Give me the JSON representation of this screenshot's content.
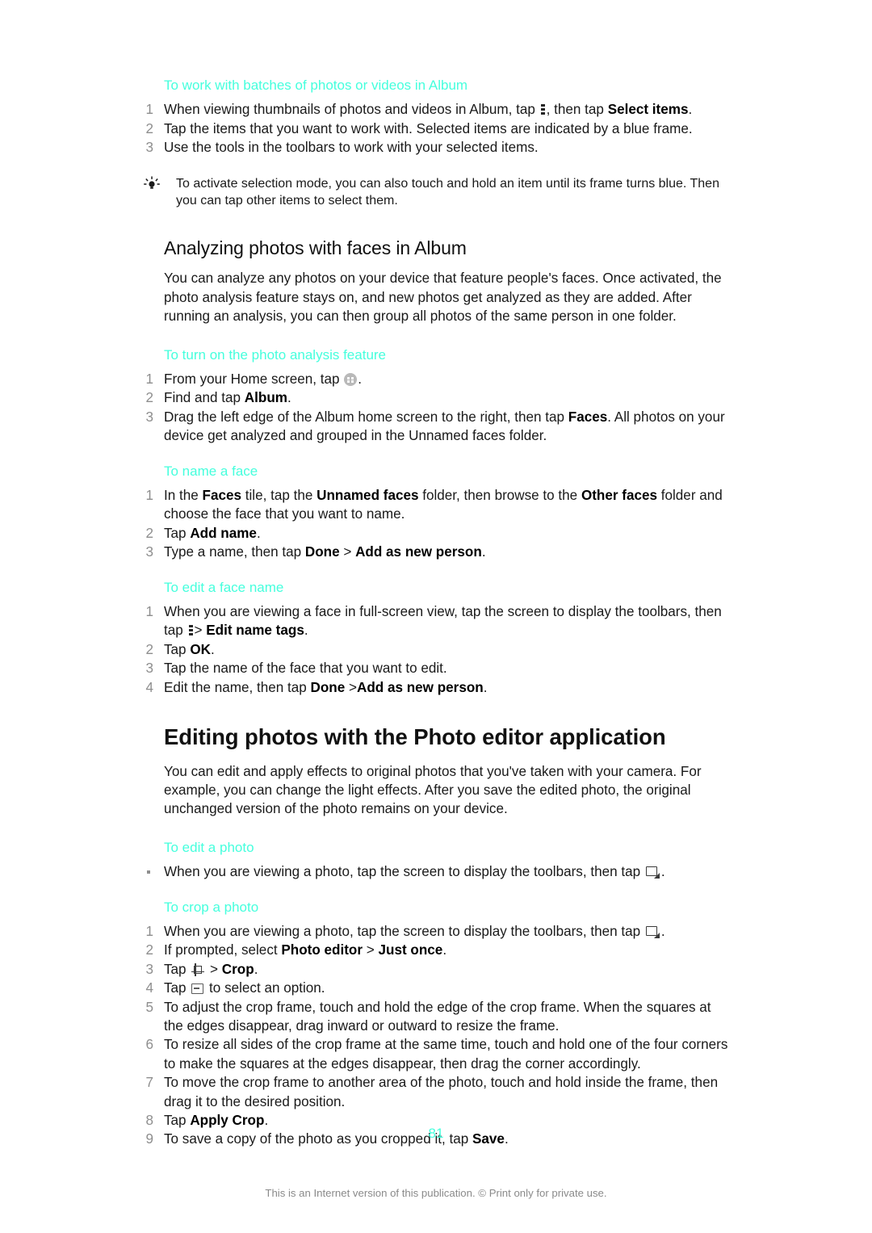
{
  "document": {
    "page_number": "81",
    "footer_note": "This is an Internet version of this publication. © Print only for private use.",
    "accent_color": "#45ffdd",
    "text_color": "#1a1a1a",
    "number_color": "#8e8e8e"
  },
  "sections": {
    "batches": {
      "heading": "To work with batches of photos or videos in Album",
      "steps": {
        "s1_a": "When viewing thumbnails of photos and videos in Album, tap ",
        "s1_icon": "overflow-menu-icon",
        "s1_b": ", then tap ",
        "s1_bold": "Select items",
        "s1_c": ".",
        "s2": "Tap the items that you want to work with. Selected items are indicated by a blue frame.",
        "s3": "Use the tools in the toolbars to work with your selected items."
      },
      "tip": "To activate selection mode, you can also touch and hold an item until its frame turns blue. Then you can tap other items to select them.",
      "tip_icon": "lightbulb-tip-icon"
    },
    "analyzing": {
      "heading": "Analyzing photos with faces in Album",
      "intro": "You can analyze any photos on your device that feature people's faces. Once activated, the photo analysis feature stays on, and new photos get analyzed as they are added. After running an analysis, you can then group all photos of the same person in one folder.",
      "turn_on": {
        "heading": "To turn on the photo analysis feature",
        "s1_a": "From your Home screen, tap ",
        "s1_icon": "app-drawer-icon",
        "s1_b": ".",
        "s2_a": "Find and tap ",
        "s2_bold": "Album",
        "s2_b": ".",
        "s3_a": "Drag the left edge of the Album home screen to the right, then tap ",
        "s3_bold": "Faces",
        "s3_b": ". All photos on your device get analyzed and grouped in the Unnamed faces folder."
      },
      "name_face": {
        "heading": "To name a face",
        "s1_a": "In the ",
        "s1_bold1": "Faces",
        "s1_b": " tile, tap the ",
        "s1_bold2": "Unnamed faces",
        "s1_c": " folder, then browse to the ",
        "s1_bold3": "Other faces",
        "s1_d": " folder and choose the face that you want to name.",
        "s2_a": "Tap ",
        "s2_bold": "Add name",
        "s2_b": ".",
        "s3_a": "Type a name, then tap ",
        "s3_bold1": "Done",
        "s3_b": " > ",
        "s3_bold2": "Add as new person",
        "s3_c": "."
      },
      "edit_face": {
        "heading": "To edit a face name",
        "s1_a": "When you are viewing a face in full-screen view, tap the screen to display the toolbars, then tap ",
        "s1_icon": "overflow-menu-icon",
        "s1_b": "> ",
        "s1_bold": "Edit name tags",
        "s1_c": ".",
        "s2_a": "Tap ",
        "s2_bold": "OK",
        "s2_b": ".",
        "s3": "Tap the name of the face that you want to edit.",
        "s4_a": "Edit the name, then tap ",
        "s4_bold1": "Done",
        "s4_b": " >",
        "s4_bold2": "Add as new person",
        "s4_c": "."
      }
    },
    "photo_editor": {
      "heading": "Editing photos with the Photo editor application",
      "intro": "You can edit and apply effects to original photos that you've taken with your camera. For example, you can change the light effects. After you save the edited photo, the original unchanged version of the photo remains on your device.",
      "edit_photo": {
        "heading": "To edit a photo",
        "b1_a": "When you are viewing a photo, tap the screen to display the toolbars, then tap ",
        "b1_icon": "photo-edit-icon",
        "b1_b": "."
      },
      "crop_photo": {
        "heading": "To crop a photo",
        "s1_a": "When you are viewing a photo, tap the screen to display the toolbars, then tap ",
        "s1_icon": "photo-edit-icon",
        "s1_b": ".",
        "s2_a": "If prompted, select ",
        "s2_bold1": "Photo editor",
        "s2_b": " > ",
        "s2_bold2": "Just once",
        "s2_c": ".",
        "s3_a": "Tap ",
        "s3_icon": "crop-tool-icon",
        "s3_b": " > ",
        "s3_bold": "Crop",
        "s3_c": ".",
        "s4_a": "Tap ",
        "s4_icon": "option-selector-icon",
        "s4_b": " to select an option.",
        "s5": "To adjust the crop frame, touch and hold the edge of the crop frame. When the squares at the edges disappear, drag inward or outward to resize the frame.",
        "s6": "To resize all sides of the crop frame at the same time, touch and hold one of the four corners to make the squares at the edges disappear, then drag the corner accordingly.",
        "s7": "To move the crop frame to another area of the photo, touch and hold inside the frame, then drag it to the desired position.",
        "s8_a": "Tap ",
        "s8_bold": "Apply Crop",
        "s8_b": ".",
        "s9_a": "To save a copy of the photo as you cropped it, tap ",
        "s9_bold": "Save",
        "s9_b": "."
      }
    }
  }
}
